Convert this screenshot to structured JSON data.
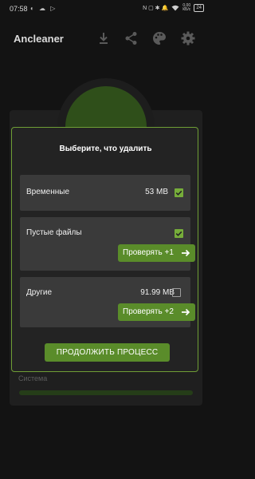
{
  "status_bar": {
    "time": "07:58",
    "left_icons": "◐ ☁ ▷",
    "right_icons": "N ▢ ✱ 🔔",
    "net_speed": "0,00",
    "net_unit": "КБ/с",
    "battery": "24"
  },
  "app_bar": {
    "title": "Ancleaner",
    "icons": [
      "download-icon",
      "share-icon",
      "palette-icon",
      "settings-icon"
    ]
  },
  "background": {
    "section_label": "Система"
  },
  "dialog": {
    "title": "Выберите, что удалить",
    "rows": [
      {
        "label": "Временные",
        "value": "53 MB",
        "checked": true
      },
      {
        "label": "Пустые файлы",
        "value": "",
        "checked": true,
        "button": "Проверять +1"
      },
      {
        "label": "Другие",
        "value": "91.99 MB",
        "checked": false,
        "button": "Проверять +2"
      }
    ],
    "continue_button": "ПРОДОЛЖИТЬ ПРОЦЕСС"
  },
  "colors": {
    "accent": "#76ad3a",
    "button": "#5a8c2a",
    "dialog_border": "#6f9e35",
    "background": "#131313"
  }
}
